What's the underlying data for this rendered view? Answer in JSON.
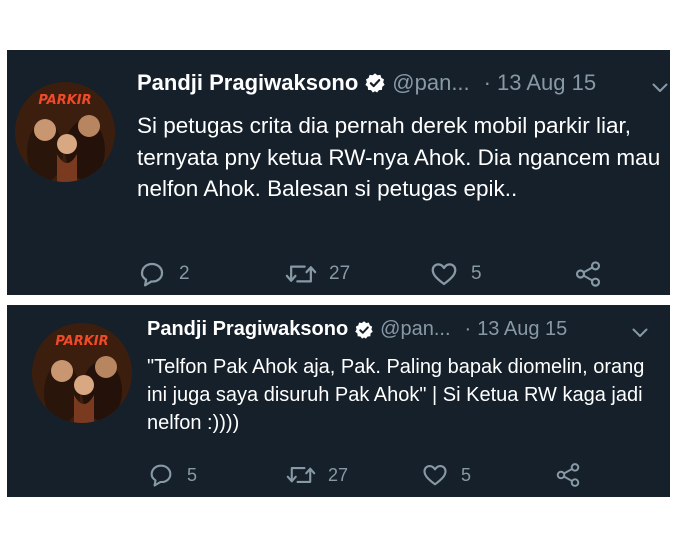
{
  "colors": {
    "background": "#15202b",
    "text": "#ffffff",
    "secondary": "#8899a6",
    "verified": "#ffffff"
  },
  "tweets": [
    {
      "name": "Pandji Pragiwaksono",
      "handle": "@pan...",
      "separator": "·",
      "date": "13 Aug 15",
      "text": "Si petugas crita dia pernah derek mobil parkir liar, ternyata pny ketua RW-nya Ahok. Dia ngancem mau nelfon Ahok. Balesan si petugas epik..",
      "avatar_label": "PARKIR",
      "replies": "2",
      "retweets": "27",
      "likes": "5",
      "icons": [
        "reply-icon",
        "retweet-icon",
        "like-icon",
        "share-icon"
      ]
    },
    {
      "name": "Pandji Pragiwaksono",
      "handle": "@pan...",
      "separator": "·",
      "date": "13 Aug 15",
      "text": "\"Telfon Pak Ahok aja, Pak. Paling bapak diomelin, orang ini juga saya disuruh Pak Ahok\" | Si Ketua RW kaga jadi nelfon :))))",
      "avatar_label": "PARKIR",
      "replies": "5",
      "retweets": "27",
      "likes": "5",
      "icons": [
        "reply-icon",
        "retweet-icon",
        "like-icon",
        "share-icon"
      ]
    }
  ]
}
